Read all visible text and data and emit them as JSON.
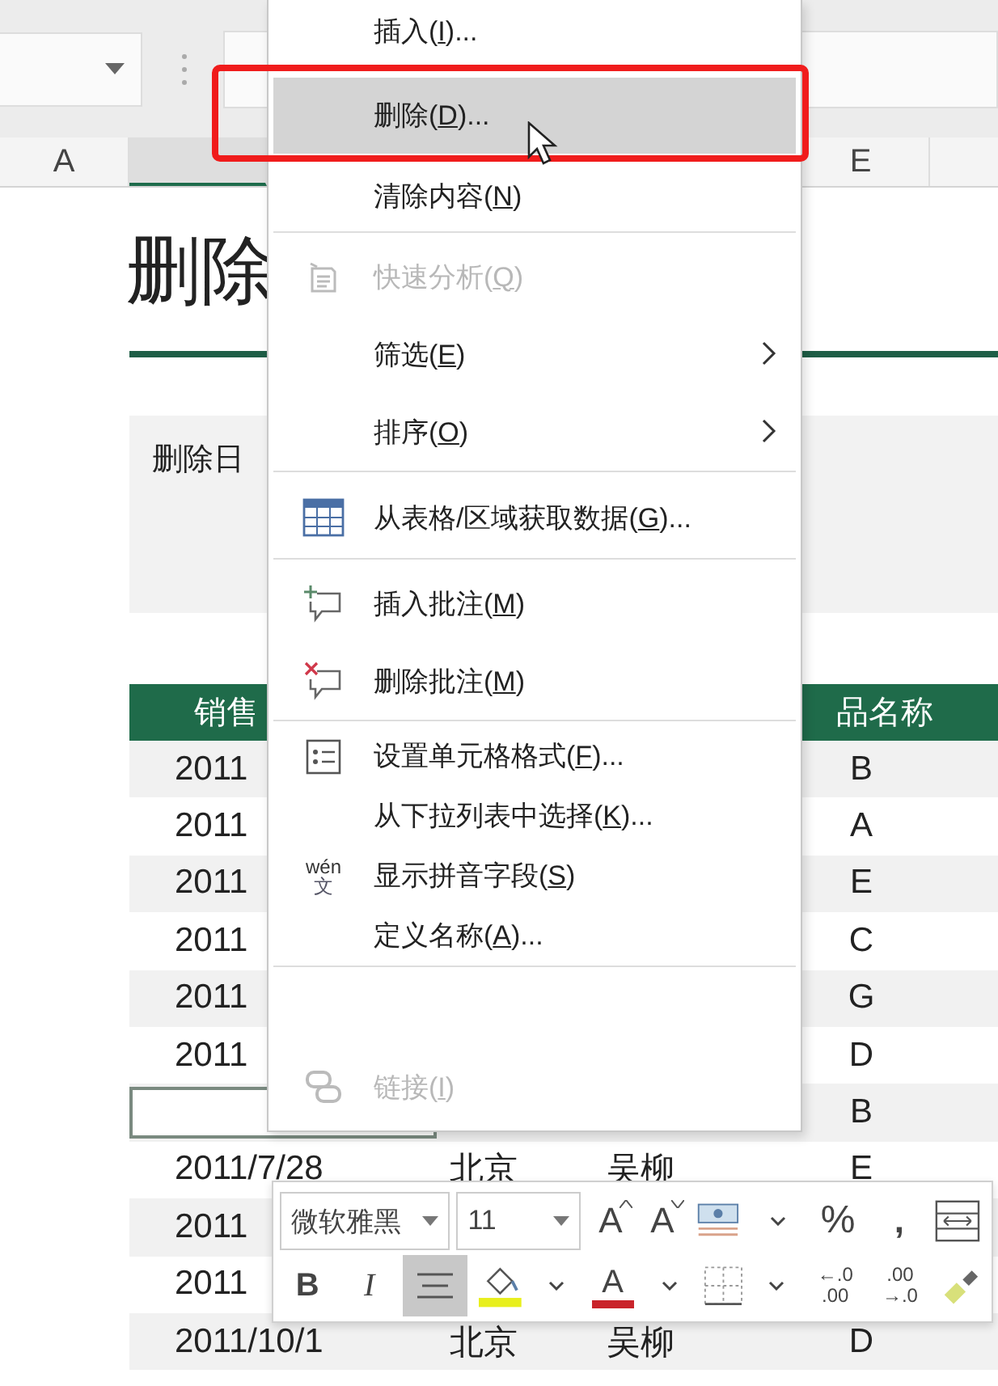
{
  "column_headers": [
    {
      "label": "A",
      "selected": false
    },
    {
      "selected": true
    },
    {
      "label": "E",
      "selected": false
    }
  ],
  "sheet": {
    "title": "删除",
    "note": "删除日",
    "header": [
      "销售",
      "品名称"
    ],
    "rows": [
      {
        "date": "2011",
        "product": "B",
        "selected": false
      },
      {
        "date": "2011",
        "product": "A",
        "selected": false
      },
      {
        "date": "2011",
        "product": "E",
        "selected": false
      },
      {
        "date": "2011",
        "product": "C",
        "selected": false
      },
      {
        "date": "2011",
        "product": "G",
        "selected": false
      },
      {
        "date": "2011",
        "product": "D",
        "selected": false
      },
      {
        "product": "B",
        "selected": true
      },
      {
        "date": "2011/7/28",
        "city": "北京",
        "person": "吴柳",
        "product": "E",
        "selected": false
      },
      {
        "date": "2011",
        "selected": false
      },
      {
        "date": "2011",
        "selected": false
      },
      {
        "date": "2011/10/1",
        "city": "北京",
        "person": "吴柳",
        "product": "D",
        "selected": false
      }
    ]
  },
  "context_menu": {
    "groups": [
      [
        {
          "kind": "command",
          "pre": "插入(",
          "key": "I",
          "post": ")...",
          "disabled": false,
          "selected": false
        },
        {
          "kind": "command",
          "pre": "删除(",
          "key": "D",
          "post": ")...",
          "disabled": false,
          "selected": true
        },
        {
          "kind": "command",
          "pre": "清除内容(",
          "key": "N",
          "post": ")",
          "disabled": false,
          "selected": false
        }
      ],
      [
        {
          "kind": "command",
          "pre": "快速分析(",
          "key": "Q",
          "post": ")",
          "disabled": true,
          "selected": false
        },
        {
          "kind": "submenu",
          "pre": "筛选(",
          "key": "E",
          "post": ")",
          "disabled": false,
          "selected": false
        },
        {
          "kind": "submenu",
          "pre": "排序(",
          "key": "O",
          "post": ")",
          "disabled": false,
          "selected": false
        }
      ],
      [
        {
          "kind": "command",
          "pre": "从表格/区域获取数据(",
          "key": "G",
          "post": ")...",
          "disabled": false,
          "selected": false
        }
      ],
      [
        {
          "kind": "command",
          "pre": "插入批注(",
          "key": "M",
          "post": ")",
          "disabled": false,
          "selected": false
        },
        {
          "kind": "command",
          "pre": "删除批注(",
          "key": "M",
          "post": ")",
          "disabled": false,
          "selected": false
        }
      ],
      [
        {
          "kind": "command",
          "pre": "设置单元格格式(",
          "key": "F",
          "post": ")...",
          "disabled": false,
          "selected": false
        },
        {
          "kind": "command",
          "pre": "从下拉列表中选择(",
          "key": "K",
          "post": ")...",
          "disabled": false,
          "selected": false
        },
        {
          "kind": "pinyin",
          "icon_text": [
            "wén",
            "文"
          ],
          "pre": "显示拼音字段(",
          "key": "S",
          "post": ")",
          "disabled": false,
          "selected": false
        },
        {
          "kind": "command",
          "pre": "定义名称(",
          "key": "A",
          "post": ")...",
          "disabled": false,
          "selected": false
        }
      ],
      [
        {
          "kind": "command",
          "pre": "链接(",
          "key": "I",
          "post": ")",
          "disabled": true,
          "selected": false
        }
      ]
    ]
  },
  "mini_toolbar": {
    "font": "微软雅黑",
    "size": "11",
    "row1": [
      {
        "kind": "grow",
        "text": "A",
        "selected": false
      },
      {
        "kind": "shrink",
        "text": "A",
        "selected": false
      },
      {
        "kind": "currency",
        "selected": false
      },
      {
        "kind": "caret",
        "selected": false
      },
      {
        "kind": "percent",
        "text": "%",
        "selected": false
      },
      {
        "kind": "comma",
        "text": ",",
        "selected": false
      },
      {
        "kind": "wrap",
        "selected": false
      }
    ],
    "row2": [
      {
        "kind": "bold",
        "text": "B",
        "selected": false
      },
      {
        "kind": "italic",
        "text": "I",
        "selected": false
      },
      {
        "kind": "align",
        "selected": true
      },
      {
        "kind": "fill",
        "selected": false
      },
      {
        "kind": "caret",
        "selected": false
      },
      {
        "kind": "fontcolor",
        "text": "A",
        "selected": false
      },
      {
        "kind": "caret",
        "selected": false
      },
      {
        "kind": "borders",
        "selected": false
      },
      {
        "kind": "caret",
        "selected": false
      },
      {
        "kind": "decimal",
        "lines": [
          "←.0",
          ".00"
        ],
        "selected": false
      },
      {
        "kind": "decimal",
        "lines": [
          ".00",
          "→.0"
        ],
        "selected": false
      },
      {
        "kind": "painter",
        "selected": false
      }
    ]
  }
}
